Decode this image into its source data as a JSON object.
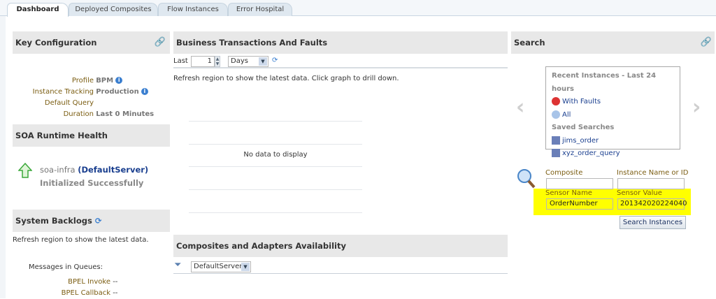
{
  "tabs": [
    {
      "label": "Dashboard"
    },
    {
      "label": "Deployed Composites"
    },
    {
      "label": "Flow Instances"
    },
    {
      "label": "Error Hospital"
    }
  ],
  "key_config": {
    "title": "Key Configuration",
    "rows": [
      {
        "label": "Profile",
        "value": "BPM"
      },
      {
        "label": "Instance Tracking",
        "value": "Production"
      },
      {
        "label": "Default Query Duration",
        "value": "Last 0 Minutes"
      }
    ]
  },
  "runtime": {
    "title": "SOA Runtime Health",
    "server": "soa-infra",
    "server_link": "(DefaultServer)",
    "status": "Initialized Successfully"
  },
  "backlogs": {
    "title": "System Backlogs",
    "refresh": "Refresh region to show the latest data.",
    "queues_label": "Messages in Queues:",
    "rows": [
      {
        "label": "BPEL Invoke",
        "value": "--"
      },
      {
        "label": "BPEL Callback",
        "value": "--"
      }
    ]
  },
  "business": {
    "title": "Business Transactions And Faults",
    "last_label": "Last",
    "last_value": "1",
    "unit": "Days",
    "refresh": "Refresh region to show the latest data. Click graph to drill down.",
    "no_data": "No data to display"
  },
  "availability": {
    "title": "Composites and Adapters Availability",
    "server": "DefaultServer"
  },
  "search": {
    "title": "Search",
    "recent_title": "Recent Instances - Last 24 hours",
    "with_faults": "With Faults",
    "all": "All",
    "saved_title": "Saved Searches",
    "saved": [
      "jims_order",
      "xyz_order_query"
    ],
    "composite_label": "Composite",
    "composite_value": "",
    "instance_label": "Instance Name or ID",
    "instance_value": "",
    "sensor_name_label": "Sensor Name",
    "sensor_name_value": "OrderNumber",
    "sensor_value_label": "Sensor Value",
    "sensor_value_value": "201342020224040",
    "button": "Search Instances",
    "highlight": "#ffff00"
  }
}
